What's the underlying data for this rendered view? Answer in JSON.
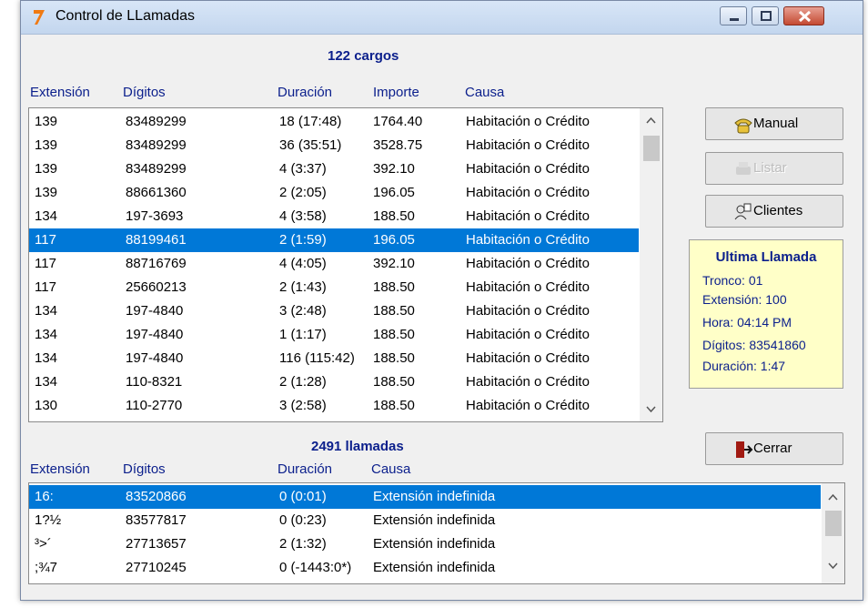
{
  "window": {
    "title": "Control de LLamadas"
  },
  "cargos": {
    "heading": "122 cargos",
    "columns": [
      "Extensión",
      "Dígitos",
      "Duración",
      "Importe",
      "Causa"
    ],
    "rows": [
      [
        "139",
        "83489299",
        "18 (17:48)",
        "1764.40",
        "Habitación o Crédito"
      ],
      [
        "139",
        "83489299",
        "36 (35:51)",
        "3528.75",
        "Habitación o Crédito"
      ],
      [
        "139",
        "83489299",
        "4 (3:37)",
        "392.10",
        "Habitación o Crédito"
      ],
      [
        "139",
        "88661360",
        "2 (2:05)",
        "196.05",
        "Habitación o Crédito"
      ],
      [
        "134",
        "197-3693",
        "4 (3:58)",
        "188.50",
        "Habitación o Crédito"
      ],
      [
        "117",
        "88199461",
        "2 (1:59)",
        "196.05",
        "Habitación o Crédito"
      ],
      [
        "117",
        "88716769",
        "4 (4:05)",
        "392.10",
        "Habitación o Crédito"
      ],
      [
        "117",
        "25660213",
        "2 (1:43)",
        "188.50",
        "Habitación o Crédito"
      ],
      [
        "134",
        "197-4840",
        "3 (2:48)",
        "188.50",
        "Habitación o Crédito"
      ],
      [
        "134",
        "197-4840",
        "1 (1:17)",
        "188.50",
        "Habitación o Crédito"
      ],
      [
        "134",
        "197-4840",
        "116 (115:42)",
        "188.50",
        "Habitación o Crédito"
      ],
      [
        "134",
        "110-8321",
        "2 (1:28)",
        "188.50",
        "Habitación o Crédito"
      ],
      [
        "130",
        "110-2770",
        "3 (2:58)",
        "188.50",
        "Habitación o Crédito"
      ]
    ],
    "selected_row": 5
  },
  "llamadas": {
    "heading": "2491 llamadas",
    "columns": [
      "Extensión",
      "Dígitos",
      "Duración",
      "Causa"
    ],
    "rows": [
      [
        "16:",
        "83520866",
        "0 (0:01)",
        "Extensión indefinida"
      ],
      [
        "1?½",
        "83577817",
        "0 (0:23)",
        "Extensión indefinida"
      ],
      [
        "³>´",
        "27713657",
        "2 (1:32)",
        "Extensión indefinida"
      ],
      [
        ";¾7",
        "27710245",
        "0 (-1443:0*)",
        "Extensión indefinida"
      ]
    ],
    "selected_row": 0
  },
  "buttons": {
    "manual": "Manual",
    "listar": "Listar",
    "clientes": "Clientes",
    "cerrar": "Cerrar"
  },
  "ultima": {
    "title": "Ultima Llamada",
    "lines": [
      "Tronco: 01",
      "Extensión: 100",
      "Hora: 04:14 PM",
      "Dígitos: 83541860",
      "Duración: 1:47"
    ]
  },
  "colors": {
    "selection": "#0078d7",
    "header_text": "#0b1f8c",
    "info_bg": "#ffffc8"
  },
  "icons": [
    "app-icon",
    "phone-icon",
    "printer-icon",
    "clients-icon",
    "exit-door-icon"
  ]
}
